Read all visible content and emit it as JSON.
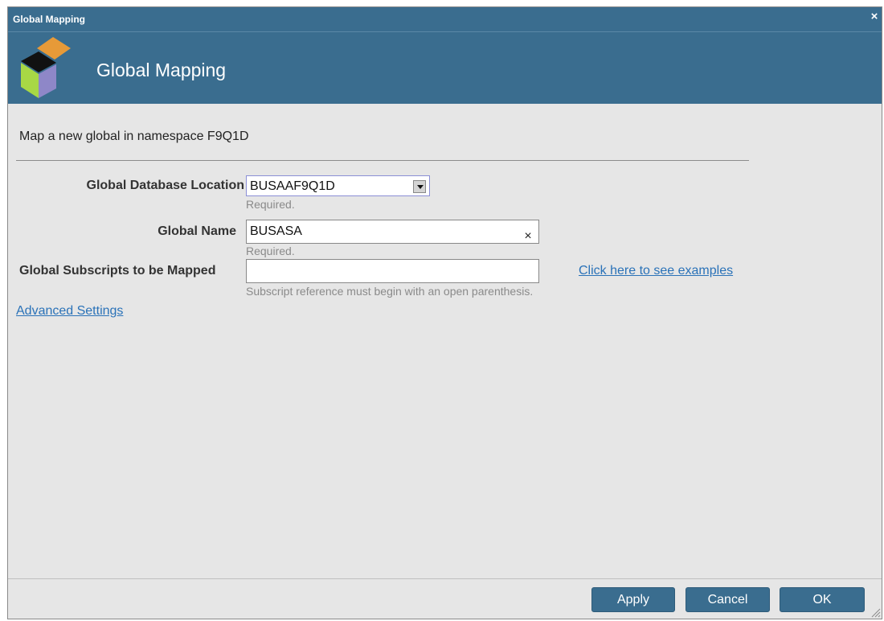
{
  "window": {
    "title": "Global Mapping",
    "close_glyph": "×"
  },
  "header": {
    "title": "Global Mapping",
    "logo_icon": "cube-logo-icon"
  },
  "intro": "Map a new global in namespace F9Q1D",
  "fields": {
    "database": {
      "label": "Global Database Location",
      "value": "BUSAAF9Q1D",
      "hint": "Required."
    },
    "name": {
      "label": "Global Name",
      "value": "BUSASA",
      "hint": "Required.",
      "clear_glyph": "×"
    },
    "subscripts": {
      "label": "Global Subscripts to be Mapped",
      "value": "",
      "hint": "Subscript reference must begin with an open parenthesis.",
      "examples_link": "Click here to see examples"
    }
  },
  "advanced_link": "Advanced Settings",
  "buttons": {
    "apply": "Apply",
    "cancel": "Cancel",
    "ok": "OK"
  },
  "colors": {
    "header_bg": "#3a6d8f",
    "link": "#2a72b8",
    "dialog_bg": "#e6e6e6"
  }
}
